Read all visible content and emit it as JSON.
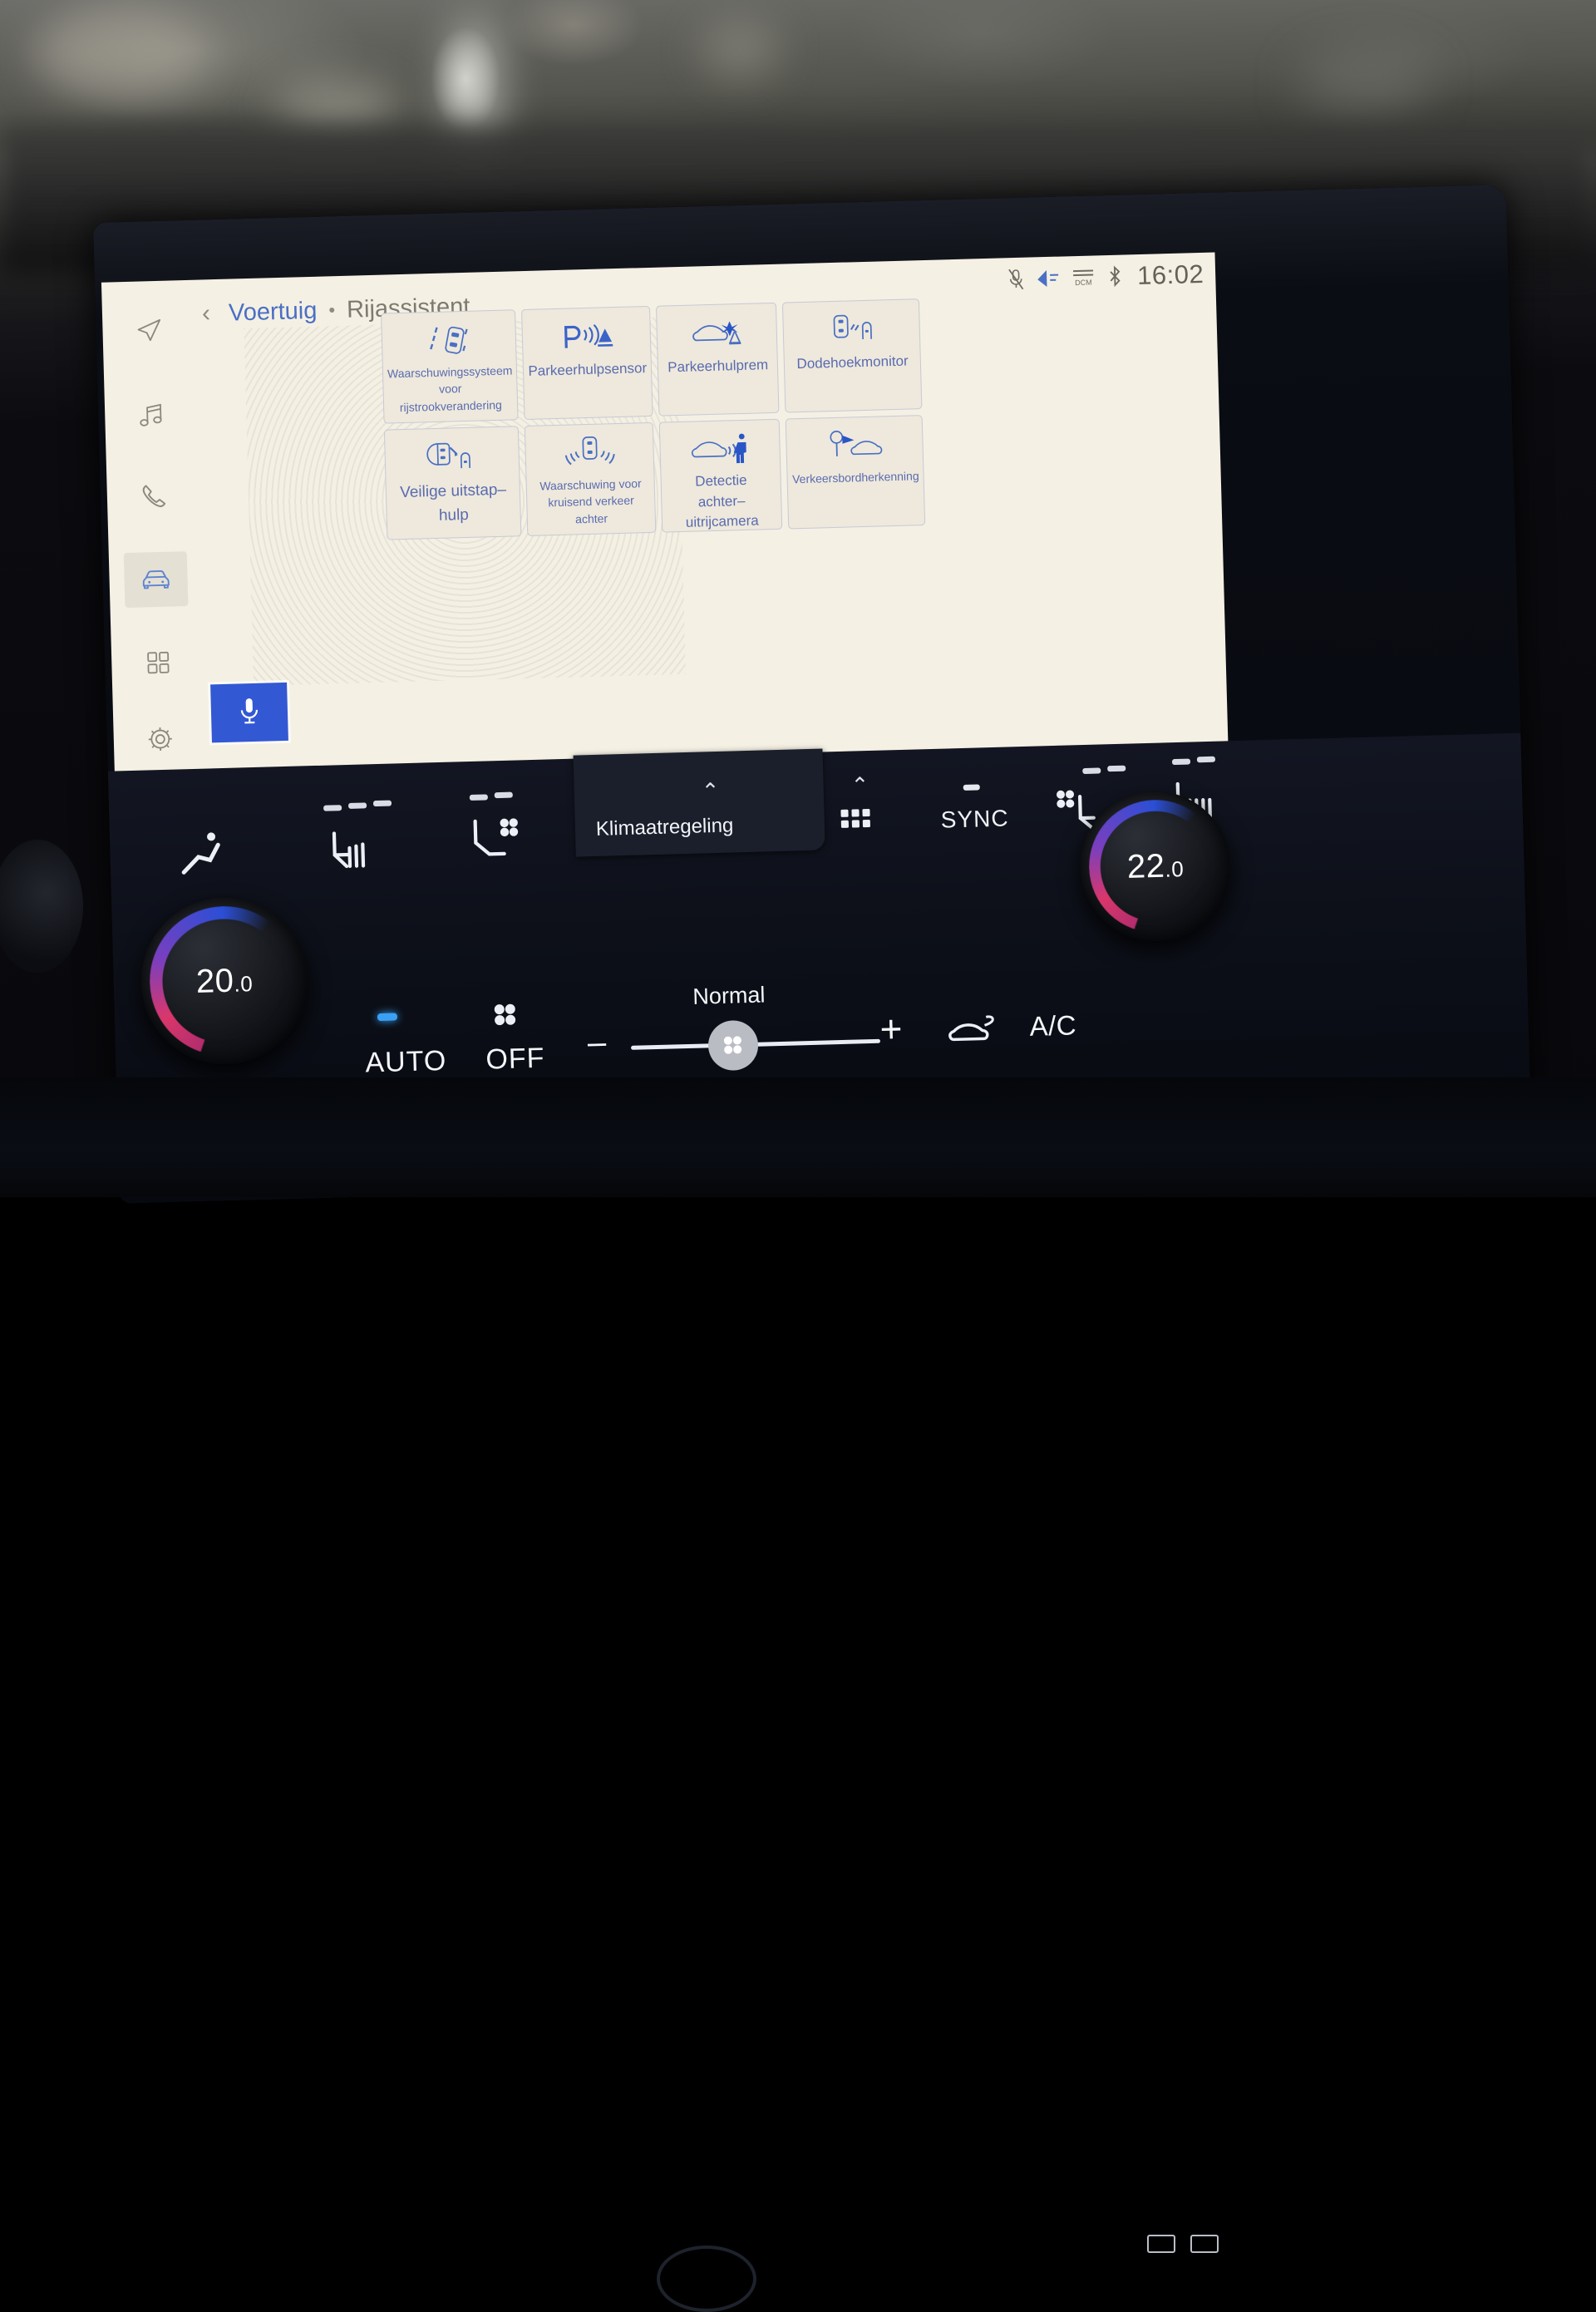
{
  "statusbar": {
    "icons": [
      "mic-muted-icon",
      "navigation-arrow-icon",
      "dcm-signal-icon",
      "bluetooth-icon"
    ],
    "clock": "16:02"
  },
  "breadcrumb": {
    "back": "‹",
    "parent": "Voertuig",
    "separator": "•",
    "current": "Rijassistent"
  },
  "sidebar": {
    "items": [
      {
        "name": "navigation",
        "icon": "navigation-arrow-icon",
        "active": false
      },
      {
        "name": "media",
        "icon": "music-note-icon",
        "active": false
      },
      {
        "name": "phone",
        "icon": "phone-icon",
        "active": false
      },
      {
        "name": "vehicle",
        "icon": "car-front-icon",
        "active": true
      },
      {
        "name": "apps",
        "icon": "apps-grid-icon",
        "active": false
      },
      {
        "name": "settings",
        "icon": "gear-icon",
        "active": false
      }
    ],
    "mic_button": "microphone-icon"
  },
  "tiles": [
    {
      "icon": "lane-change-warning-icon",
      "label": "Waarschuwingssysteem\nvoor rijstrookverandering",
      "size": "sm"
    },
    {
      "icon": "parking-sensor-icon",
      "label": "Parkeerhulpsensor",
      "size": "md"
    },
    {
      "icon": "parking-brake-assist-icon",
      "label": "Parkeerhulprem",
      "size": "md"
    },
    {
      "icon": "blind-spot-monitor-icon",
      "label": "Dodehoekmonitor",
      "size": "md"
    },
    {
      "icon": "safe-exit-assist-icon",
      "label": "Veilige uitstap–\nhulp",
      "size": "lg"
    },
    {
      "icon": "rear-cross-traffic-icon",
      "label": "Waarschuwing voor\nkruisend verkeer achter",
      "size": "sm"
    },
    {
      "icon": "rear-camera-detection-icon",
      "label": "Detectie\nachter–uitrijcamera",
      "size": "md"
    },
    {
      "icon": "traffic-sign-recognition-icon",
      "label": "Verkeersbordherkenning",
      "size": "sm"
    }
  ],
  "climate": {
    "klimaatregeling_label": "Klimaatregeling",
    "chevron_up": "⌃",
    "sync_label": "SYNC",
    "auto_label": "AUTO",
    "off_label": "OFF",
    "minus_label": "–",
    "plus_label": "+",
    "ac_label": "A/C",
    "fan_mode_label": "Normal",
    "icons": [
      "seat-position-icon",
      "seat-heater-icon",
      "seat-ventilation-icon",
      "steering-wheel-heater-icon",
      "apps-grid-small-icon",
      "seat-heater-right-icon",
      "seat-heater-rear-icon",
      "fan-icon",
      "recirculation-icon"
    ]
  },
  "temperature": {
    "left": "20.0",
    "left_int": "20",
    "left_dec": ".0",
    "right": "22.0",
    "right_int": "22",
    "right_dec": ".0"
  },
  "colors": {
    "accent_blue": "#4a6fc4",
    "tile_label": "#5a6bb0",
    "screen_bg": "#f4f0e4",
    "mic_button": "#3358d4",
    "climate_bg": "#0d1019",
    "auto_led": "#3aa0f5"
  }
}
